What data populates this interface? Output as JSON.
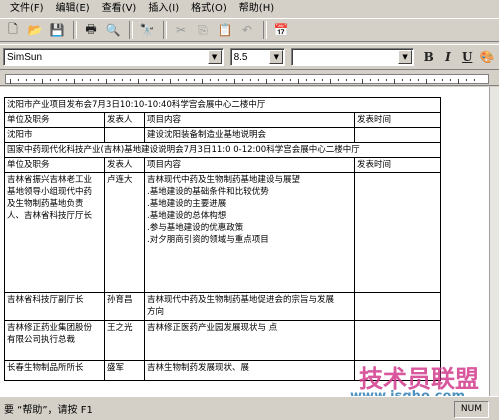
{
  "menu": [
    "文件(F)",
    "编辑(E)",
    "查看(V)",
    "插入(I)",
    "格式(O)",
    "帮助(H)"
  ],
  "toolbar2": {
    "font": "SimSun",
    "size": "8.5",
    "script": "",
    "bold": "B",
    "italic": "I",
    "underline": "U"
  },
  "rows": [
    {
      "merged": "沈阳市产业项目发布会7月3日10:10-10:40科学宫会展中心二楼中厅"
    },
    {
      "cells": [
        "单位及职务",
        "发表人",
        "项目内容",
        "发表时间"
      ]
    },
    {
      "cells": [
        "沈阳市",
        "",
        "建设沈阳装备制造业基地说明会",
        ""
      ]
    },
    {
      "merged": "国家中药现代化科技产业(吉林)基地建设说明会7月3日11:0 0-12:00科学宫会展中心二楼中厅"
    },
    {
      "cells": [
        "单位及职务",
        "发表人",
        "项目内容",
        "发表时间"
      ]
    },
    {
      "cells": [
        "吉林省振兴吉林老工业\n基地领导小组现代中药\n及生物制药基地负责\n人、吉林省科技厅厅长",
        "卢连大",
        "吉林现代中药及生物制药基地建设与展望\n.基地建设的基础条件和比较优势\n.基地建设的主要进展\n.基地建设的总体构想\n.参与基地建设的优惠政策\n.对夕朋商引资的领域与重点项目",
        ""
      ]
    },
    {
      "cells": [
        "吉林省科技厅副厅长",
        "孙育昌",
        "吉林现代中药及生物制药基地促进会的宗旨与发展\n方向",
        ""
      ]
    },
    {
      "cells": [
        "吉林修正药业集团股份\n有限公司执行总裁",
        "王之光",
        "吉林修正医药产业园发展现状与 点",
        ""
      ]
    },
    {
      "cells": [
        "长春生物制品所所长",
        "盛军",
        "吉林生物制药发展现状、展",
        ""
      ]
    }
  ],
  "status": "要 “帮助”，请按 F1",
  "num": "NUM",
  "watermark": "技术员联盟",
  "watermark_url": "www.jsgho.com"
}
